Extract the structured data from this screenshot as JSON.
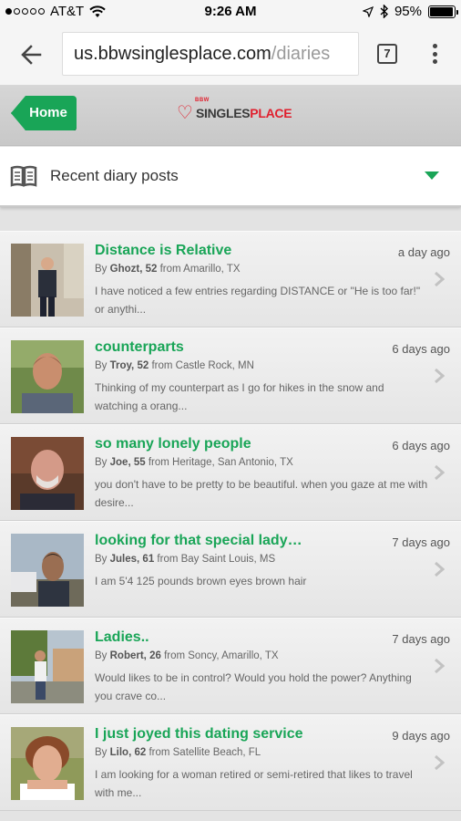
{
  "status_bar": {
    "carrier": "AT&T",
    "time": "9:26 AM",
    "battery": "95%",
    "battery_level": 0.95
  },
  "browser": {
    "url_host": "us.bbwsinglesplace.com",
    "url_path": "/diaries",
    "tab_count": "7"
  },
  "header": {
    "home_label": "Home",
    "logo_tag": "BBW",
    "logo_singles": "SINGLES",
    "logo_place": "PLACE",
    "accent_color": "#19a557",
    "brand_red": "#e0202e"
  },
  "section": {
    "title": "Recent diary posts"
  },
  "posts": [
    {
      "title": "Distance is Relative",
      "time": "a day ago",
      "by": "By ",
      "author": "Ghozt, 52",
      "location": " from Amarillo, TX",
      "excerpt": "I have noticed a few entries regarding DISTANCE or \"He is too far!\" or anythi..."
    },
    {
      "title": "counterparts",
      "time": "6 days ago",
      "by": "By ",
      "author": "Troy, 52",
      "location": " from Castle Rock, MN",
      "excerpt": "Thinking of my counterpart as I go for hikes in the snow and watching a orang..."
    },
    {
      "title": "so many lonely people",
      "time": "6 days ago",
      "by": "By ",
      "author": "Joe, 55",
      "location": " from Heritage, San Antonio, TX",
      "excerpt": "you don't have to be pretty to be beautiful. when you gaze at me with desire..."
    },
    {
      "title": "looking for that special lady…",
      "time": "7 days ago",
      "by": "By ",
      "author": "Jules, 61",
      "location": " from Bay Saint Louis, MS",
      "excerpt": "I am 5'4 125 pounds brown eyes brown hair"
    },
    {
      "title": "Ladies..",
      "time": "7 days ago",
      "by": "By ",
      "author": "Robert, 26",
      "location": " from Soncy, Amarillo, TX",
      "excerpt": "Would likes to be in control? Would you hold the power? Anything you crave co..."
    },
    {
      "title": "I just joyed this dating service",
      "time": "9 days ago",
      "by": "By ",
      "author": "Lilo, 62",
      "location": " from Satellite Beach, FL",
      "excerpt": "I am looking for a woman retired or semi-retired that likes to travel with me..."
    }
  ]
}
